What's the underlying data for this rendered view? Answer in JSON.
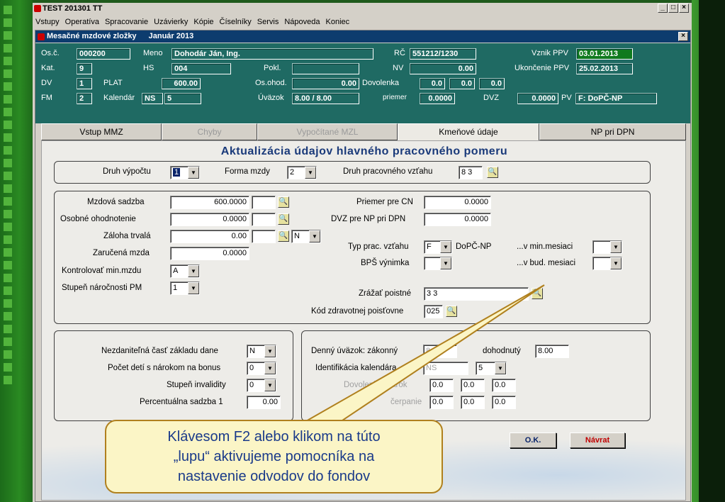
{
  "app": {
    "title": "TEST 201301 TT"
  },
  "menu": [
    "Vstupy",
    "Operatíva",
    "Spracovanie",
    "Uzávierky",
    "Kópie",
    "Číselníky",
    "Servis",
    "Nápoveda",
    "Koniec"
  ],
  "window": {
    "title": "Mesačné mzdové zložky",
    "period": "Január 2013"
  },
  "header": {
    "osc_label": "Os.č.",
    "osc": "000200",
    "meno_label": "Meno",
    "meno": "Dohodár Ján, Ing.",
    "rc_label": "RČ",
    "rc": "551212/1230",
    "vznik_label": "Vznik PPV",
    "vznik": "03.01.2013",
    "kat_label": "Kat.",
    "kat": "9",
    "hs_label": "HS",
    "hs": "004",
    "pokl_label": "Pokl.",
    "pokl": "",
    "nv_label": "NV",
    "nv": "0.00",
    "ukoncenie_label": "Ukončenie PPV",
    "ukoncenie": "25.02.2013",
    "dv_label": "DV",
    "dv": "1",
    "plat_label": "PLAT",
    "plat": "600.00",
    "osohod_label": "Os.ohod.",
    "osohod": "0.00",
    "dovolenka_label": "Dovolenka",
    "dov1": "0.0",
    "dov2": "0.0",
    "dov3": "0.0",
    "fm_label": "FM",
    "fm": "2",
    "kalendar_label": "Kalendár",
    "kalendar": "NS",
    "kalendar2": "5",
    "uvazok_label": "Úväzok",
    "uvazok": "8.00 / 8.00",
    "priemer_label": "priemer",
    "priemer": "0.0000",
    "dvz_label": "DVZ",
    "dvz": "0.0000",
    "pv_label": "PV",
    "pv": "F: DoPČ-NP"
  },
  "tabs": [
    {
      "label": "Vstup MMZ",
      "state": "normal"
    },
    {
      "label": "Chyby",
      "state": "disabled"
    },
    {
      "label": "Vypočítané MZL",
      "state": "disabled"
    },
    {
      "label": "Kmeňové údaje",
      "state": "active"
    },
    {
      "label": "NP pri DPN",
      "state": "normal"
    }
  ],
  "panel": {
    "title": "Aktualizácia údajov hlavného pracovného pomeru",
    "druh_vypoctu_label": "Druh výpočtu",
    "druh_vypoctu": "1",
    "forma_mzdy_label": "Forma mzdy",
    "forma_mzdy": "2",
    "druh_pv_label": "Druh pracovného vzťahu",
    "druh_pv": "8 3",
    "mzdova_sadzba_label": "Mzdová sadzba",
    "mzdova_sadzba": "600.0000",
    "osobne_label": "Osobné ohodnotenie",
    "osobne": "0.0000",
    "zaloha_label": "Záloha trvalá",
    "zaloha": "0.00",
    "zaloha_flag": "N",
    "zarucena_label": "Zaručená mzda",
    "zarucena": "0.0000",
    "kontrol_label": "Kontrolovať min.mzdu",
    "kontrol": "A",
    "stupen_label": "Stupeň náročnosti PM",
    "stupen": "1",
    "priemer_cn_label": "Priemer pre CN",
    "priemer_cn": "0.0000",
    "dvz_np_label": "DVZ pre NP pri DPN",
    "dvz_np": "0.0000",
    "typ_label": "Typ prac. vzťahu",
    "typ": "F",
    "typ_desc": "DoPČ-NP",
    "vmin_label": "...v min.mesiaci",
    "vbud_label": "...v bud. mesiaci",
    "bps_label": "BPŠ výnimka",
    "zrazat_label": "Zrážať poistné",
    "zrazat": "3 3",
    "kod_zp_label": "Kód zdravotnej poisťovne",
    "kod_zp": "025",
    "nezdan_label": "Nezdaniteľná časť základu dane",
    "nezdan": "N",
    "pocet_deti_label": "Počet detí s nárokom na bonus",
    "pocet_deti": "0",
    "invalidita_label": "Stupeň invalidity",
    "invalidita": "0",
    "percent_label": "Percentuálna sadzba 1",
    "percent": "0.00",
    "denny_label": "Denný úväzok: zákonný",
    "denny_zak": "8.00",
    "dohodnuty_label": "dohodnutý",
    "dohodnuty": "8.00",
    "ident_label": "Identifikácia kalendára",
    "ident": "NS",
    "ident2": "5",
    "dov_narok_label": "Dovolenka: nárok",
    "nar1": "0.0",
    "nar2": "0.0",
    "nar3": "0.0",
    "cerpanie_label": "čerpanie",
    "cer1": "0.0",
    "cer2": "0.0",
    "cer3": "0.0",
    "ok_label": "O.K.",
    "navrat_label": "Návrat"
  },
  "callout": {
    "line1": "Klávesom F2 alebo klikom na túto",
    "line2": "„lupu“ aktivujeme pomocníka na",
    "line3": "nastavenie odvodov do fondov"
  },
  "colors": {
    "header_bg": "#1f6a63",
    "title_blue": "#1a3a7a",
    "navrat_red": "#c00000",
    "callout_bg": "#fbf5c6"
  }
}
